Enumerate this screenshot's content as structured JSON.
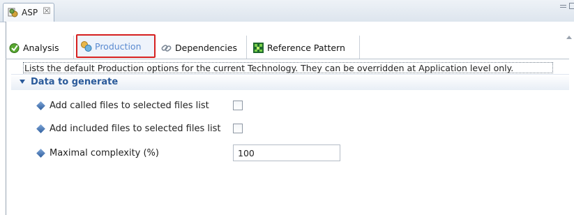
{
  "editor": {
    "tab_title": "ASP",
    "close_glyph": "☒"
  },
  "form_tabs": [
    {
      "label": "Analysis",
      "icon": "analysis-check-icon"
    },
    {
      "label": "Production",
      "icon": "production-gears-icon",
      "selected": true
    },
    {
      "label": "Dependencies",
      "icon": "dependencies-chain-icon"
    },
    {
      "label": "Reference Pattern",
      "icon": "reference-pattern-icon"
    }
  ],
  "description": "Lists the default Production options for the current Technology. They can be overridden at Application level only.",
  "section": {
    "title": "Data to generate",
    "rows": [
      {
        "label": "Add called files to selected files list",
        "checked": false
      },
      {
        "label": "Add included files to selected files list",
        "checked": false
      },
      {
        "label": "Maximal complexity (%)",
        "value": "100"
      }
    ]
  },
  "colors": {
    "accent": "#2a5a9a",
    "selected_tab_text": "#5a8ad0",
    "highlight_border": "#d62020"
  }
}
